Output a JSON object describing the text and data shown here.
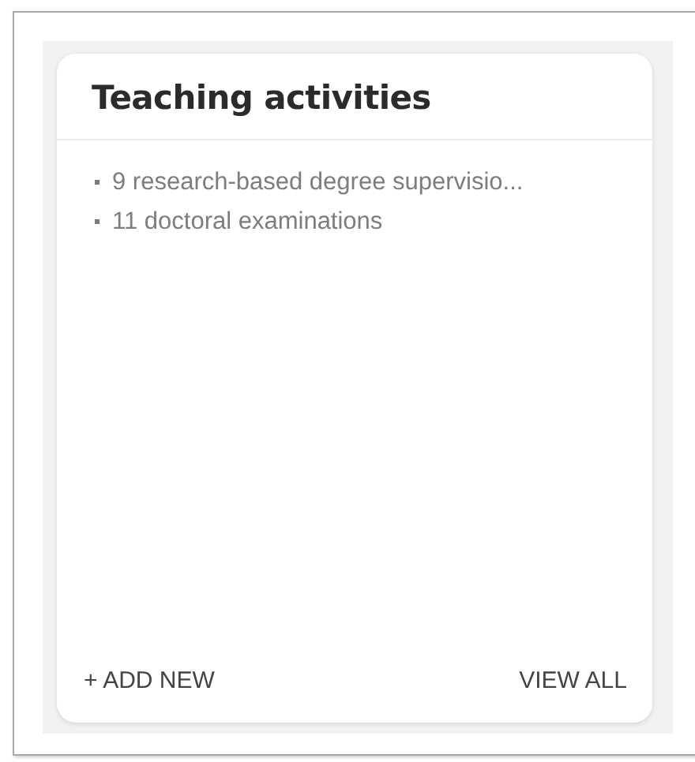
{
  "card": {
    "title": "Teaching activities",
    "items": [
      "9 research-based degree supervisio...",
      "11 doctoral examinations"
    ],
    "actions": [
      "+ ADD NEW",
      "VIEW ALL"
    ]
  }
}
